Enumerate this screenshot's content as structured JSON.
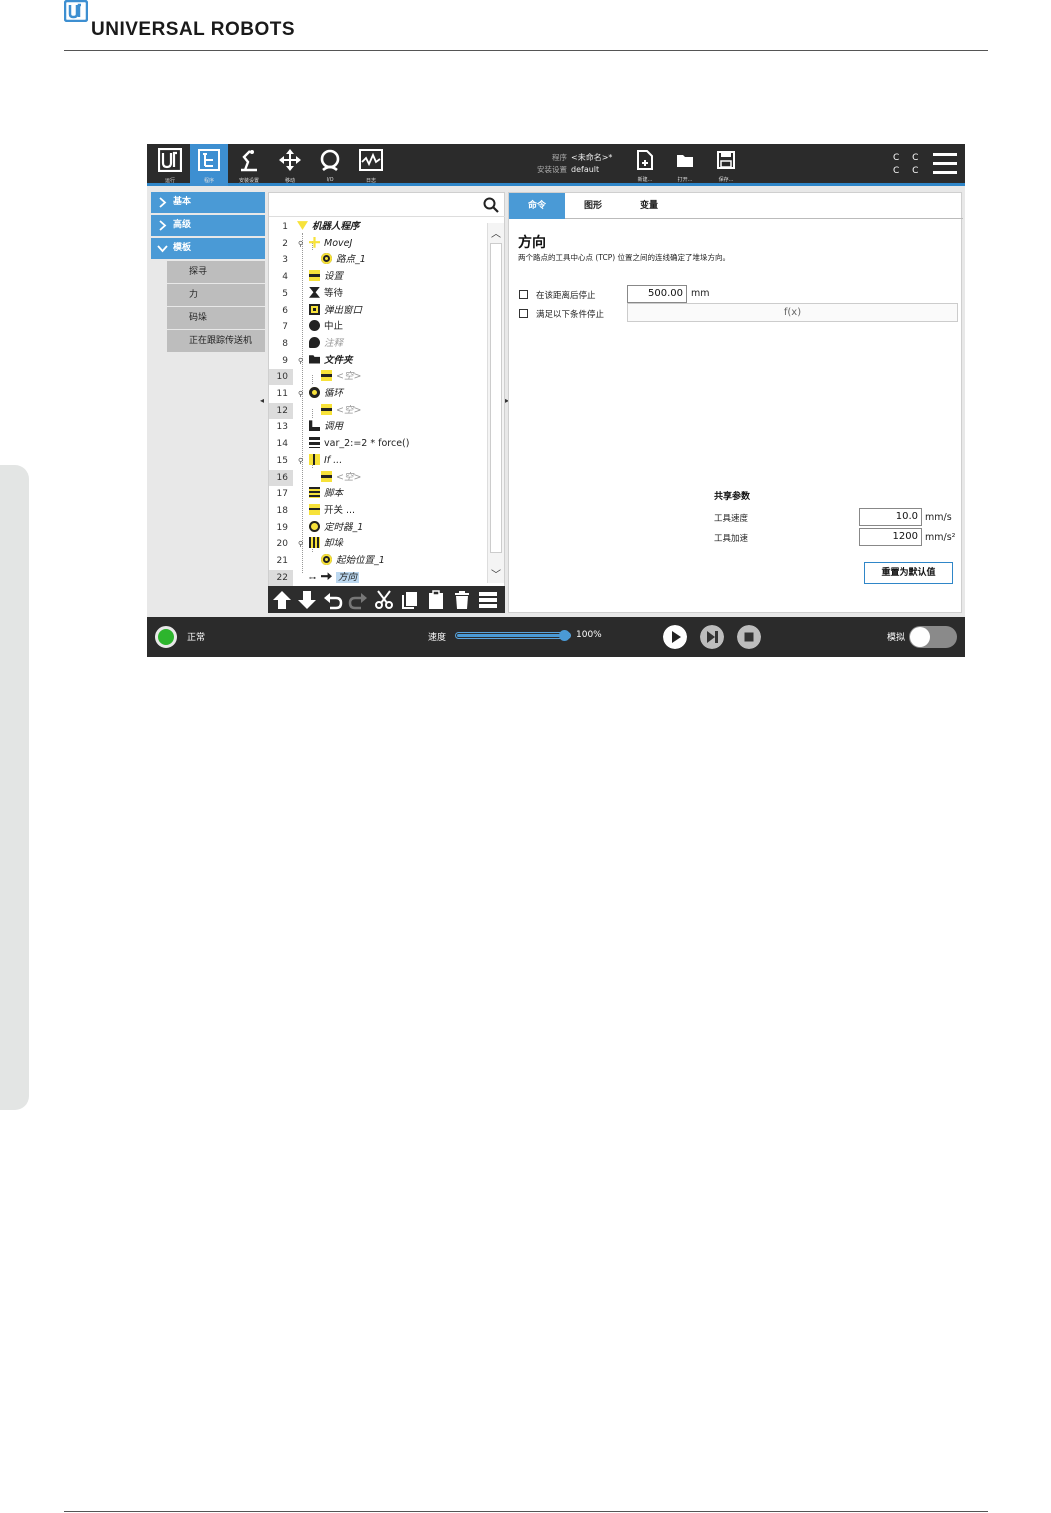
{
  "brand": {
    "name": "UNIVERSAL ROBOTS"
  },
  "topbar": {
    "nav": [
      {
        "label": "运行",
        "icon": "ur-logo-icon"
      },
      {
        "label": "程序",
        "icon": "program-icon",
        "active": true
      },
      {
        "label": "安装设置",
        "icon": "installation-icon"
      },
      {
        "label": "移动",
        "icon": "move-icon"
      },
      {
        "label": "I/O",
        "icon": "io-icon"
      },
      {
        "label": "日志",
        "icon": "log-icon"
      }
    ],
    "program_label": "程序",
    "program_value": "<未命名>*",
    "installation_label": "安装设置",
    "installation_value": "default",
    "file_buttons": [
      {
        "label": "新建...",
        "icon": "new-file-icon"
      },
      {
        "label": "打开...",
        "icon": "open-folder-icon"
      },
      {
        "label": "保存...",
        "icon": "save-icon"
      }
    ],
    "cc_text": "CC CC"
  },
  "sidebar": {
    "categories": [
      {
        "label": "基本",
        "expanded": false
      },
      {
        "label": "高级",
        "expanded": false
      },
      {
        "label": "模板",
        "expanded": true
      }
    ],
    "template_items": [
      "探寻",
      "力",
      "码垛",
      "正在跟踪传送机"
    ]
  },
  "tree": {
    "search_placeholder": "",
    "rows": [
      {
        "n": "1",
        "text": "机器人程序",
        "icon": "down-arrow-icon"
      },
      {
        "n": "2",
        "text": "MoveJ",
        "icon": "move-icon"
      },
      {
        "n": "3",
        "text": "路点_1",
        "icon": "waypoint-icon"
      },
      {
        "n": "4",
        "text": "设置",
        "icon": "set-icon"
      },
      {
        "n": "5",
        "text": "等待",
        "icon": "hourglass-icon"
      },
      {
        "n": "6",
        "text": "弹出窗口",
        "icon": "popup-icon"
      },
      {
        "n": "7",
        "text": "中止",
        "icon": "halt-icon"
      },
      {
        "n": "8",
        "text": "注释",
        "icon": "comment-icon"
      },
      {
        "n": "9",
        "text": "文件夹",
        "icon": "folder-icon"
      },
      {
        "n": "10",
        "text": "<空>",
        "icon": "empty-icon"
      },
      {
        "n": "11",
        "text": "循环",
        "icon": "loop-icon"
      },
      {
        "n": "12",
        "text": "<空>",
        "icon": "empty-icon"
      },
      {
        "n": "13",
        "text": "调用",
        "icon": "call-icon"
      },
      {
        "n": "14",
        "text": "var_2:=2 * force()",
        "icon": "assignment-icon"
      },
      {
        "n": "15",
        "text": "If ...",
        "icon": "if-icon"
      },
      {
        "n": "16",
        "text": "<空>",
        "icon": "empty-icon"
      },
      {
        "n": "17",
        "text": "脚本",
        "icon": "script-icon"
      },
      {
        "n": "18",
        "text": "开关 ...",
        "icon": "switch-icon"
      },
      {
        "n": "19",
        "text": "定时器_1",
        "icon": "timer-icon"
      },
      {
        "n": "20",
        "text": "卸垛",
        "icon": "depallet-icon"
      },
      {
        "n": "21",
        "text": "起始位置_1",
        "icon": "waypoint-icon"
      },
      {
        "n": "22",
        "text": "方向",
        "icon": "direction-icon"
      }
    ]
  },
  "command": {
    "tabs": [
      "命令",
      "图形",
      "变量"
    ],
    "title": "方向",
    "description": "两个路点的工具中心点 (TCP) 位置之间的连线确定了堆垛方向。",
    "stop_after_distance_label": "在该距离后停止",
    "stop_after_distance_value": "500.00",
    "stop_after_distance_unit": "mm",
    "stop_condition_label": "满足以下条件停止",
    "stop_condition_value": "f(x)",
    "shared_params_title": "共享参数",
    "tool_speed_label": "工具速度",
    "tool_speed_value": "10.0",
    "tool_speed_unit": "mm/s",
    "tool_accel_label": "工具加速",
    "tool_accel_value": "1200",
    "tool_accel_unit": "mm/s²",
    "reset_button": "重置为默认值"
  },
  "bottombar": {
    "status": "正常",
    "speed_label": "速度",
    "speed_value": "100%",
    "speed_fraction": 1.0,
    "simulation_label": "模拟",
    "simulation_on": false,
    "status_color": "#2db52d"
  }
}
